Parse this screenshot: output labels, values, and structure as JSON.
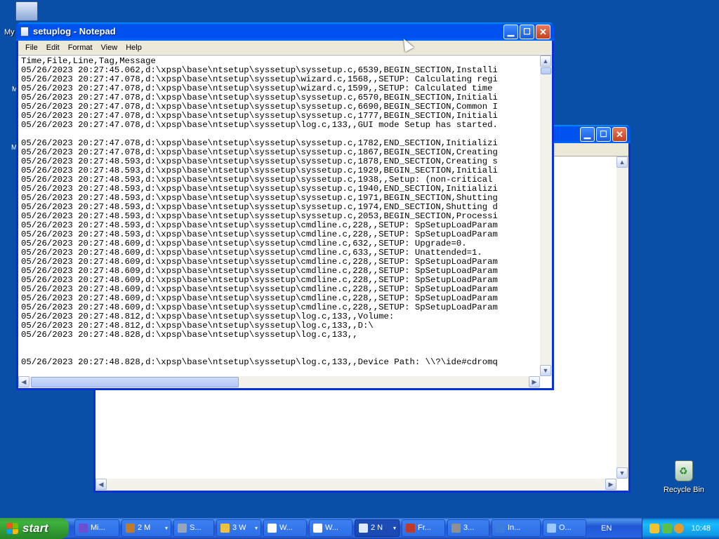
{
  "desktop": {
    "my_computer_label": "My",
    "fragment_1": "M",
    "fragment_2": "M",
    "recycle_bin_label": "Recycle Bin"
  },
  "notepad": {
    "title": "setuplog - Notepad",
    "menu": [
      "File",
      "Edit",
      "Format",
      "View",
      "Help"
    ],
    "lines": [
      "Time,File,Line,Tag,Message",
      "05/26/2023 20:27:45.062,d:\\xpsp\\base\\ntsetup\\syssetup\\syssetup.c,6539,BEGIN_SECTION,Installi",
      "05/26/2023 20:27:47.078,d:\\xpsp\\base\\ntsetup\\syssetup\\wizard.c,1568,,SETUP: Calculating regi",
      "05/26/2023 20:27:47.078,d:\\xpsp\\base\\ntsetup\\syssetup\\wizard.c,1599,,SETUP: Calculated time",
      "05/26/2023 20:27:47.078,d:\\xpsp\\base\\ntsetup\\syssetup\\syssetup.c,6570,BEGIN_SECTION,Initiali",
      "05/26/2023 20:27:47.078,d:\\xpsp\\base\\ntsetup\\syssetup\\syssetup.c,6690,BEGIN_SECTION,Common I",
      "05/26/2023 20:27:47.078,d:\\xpsp\\base\\ntsetup\\syssetup\\syssetup.c,1777,BEGIN_SECTION,Initiali",
      "05/26/2023 20:27:47.078,d:\\xpsp\\base\\ntsetup\\syssetup\\log.c,133,,GUI mode Setup has started.",
      "",
      "05/26/2023 20:27:47.078,d:\\xpsp\\base\\ntsetup\\syssetup\\syssetup.c,1782,END_SECTION,Initializi",
      "05/26/2023 20:27:47.078,d:\\xpsp\\base\\ntsetup\\syssetup\\syssetup.c,1867,BEGIN_SECTION,Creating",
      "05/26/2023 20:27:48.593,d:\\xpsp\\base\\ntsetup\\syssetup\\syssetup.c,1878,END_SECTION,Creating s",
      "05/26/2023 20:27:48.593,d:\\xpsp\\base\\ntsetup\\syssetup\\syssetup.c,1929,BEGIN_SECTION,Initiali",
      "05/26/2023 20:27:48.593,d:\\xpsp\\base\\ntsetup\\syssetup\\syssetup.c,1938,,Setup: (non-critical",
      "05/26/2023 20:27:48.593,d:\\xpsp\\base\\ntsetup\\syssetup\\syssetup.c,1940,END_SECTION,Initializi",
      "05/26/2023 20:27:48.593,d:\\xpsp\\base\\ntsetup\\syssetup\\syssetup.c,1971,BEGIN_SECTION,Shutting",
      "05/26/2023 20:27:48.593,d:\\xpsp\\base\\ntsetup\\syssetup\\syssetup.c,1974,END_SECTION,Shutting d",
      "05/26/2023 20:27:48.593,d:\\xpsp\\base\\ntsetup\\syssetup\\syssetup.c,2053,BEGIN_SECTION,Processi",
      "05/26/2023 20:27:48.593,d:\\xpsp\\base\\ntsetup\\syssetup\\cmdline.c,228,,SETUP: SpSetupLoadParam",
      "05/26/2023 20:27:48.593,d:\\xpsp\\base\\ntsetup\\syssetup\\cmdline.c,228,,SETUP: SpSetupLoadParam",
      "05/26/2023 20:27:48.609,d:\\xpsp\\base\\ntsetup\\syssetup\\cmdline.c,632,,SETUP: Upgrade=0.",
      "05/26/2023 20:27:48.609,d:\\xpsp\\base\\ntsetup\\syssetup\\cmdline.c,633,,SETUP: Unattended=1.",
      "05/26/2023 20:27:48.609,d:\\xpsp\\base\\ntsetup\\syssetup\\cmdline.c,228,,SETUP: SpSetupLoadParam",
      "05/26/2023 20:27:48.609,d:\\xpsp\\base\\ntsetup\\syssetup\\cmdline.c,228,,SETUP: SpSetupLoadParam",
      "05/26/2023 20:27:48.609,d:\\xpsp\\base\\ntsetup\\syssetup\\cmdline.c,228,,SETUP: SpSetupLoadParam",
      "05/26/2023 20:27:48.609,d:\\xpsp\\base\\ntsetup\\syssetup\\cmdline.c,228,,SETUP: SpSetupLoadParam",
      "05/26/2023 20:27:48.609,d:\\xpsp\\base\\ntsetup\\syssetup\\cmdline.c,228,,SETUP: SpSetupLoadParam",
      "05/26/2023 20:27:48.609,d:\\xpsp\\base\\ntsetup\\syssetup\\cmdline.c,228,,SETUP: SpSetupLoadParam",
      "05/26/2023 20:27:48.812,d:\\xpsp\\base\\ntsetup\\syssetup\\log.c,133,,Volume:",
      "05/26/2023 20:27:48.812,d:\\xpsp\\base\\ntsetup\\syssetup\\log.c,133,,D:\\",
      "05/26/2023 20:27:48.828,d:\\xpsp\\base\\ntsetup\\syssetup\\log.c,133,,",
      "",
      "",
      "05/26/2023 20:27:48.828,d:\\xpsp\\base\\ntsetup\\syssetup\\log.c,133,,Device Path: \\\\?\\ide#cdromq"
    ]
  },
  "taskbar": {
    "start_label": "start",
    "tasks": [
      {
        "label": "Mi...",
        "color": "#6a4fd0"
      },
      {
        "label": "2 M",
        "color": "#c07b2a",
        "arrow": "▾"
      },
      {
        "label": "S...",
        "color": "#9aa4b8"
      },
      {
        "label": "3 W",
        "color": "#f0c040",
        "arrow": "▾"
      },
      {
        "label": "W...",
        "color": "#ffffff"
      },
      {
        "label": "W...",
        "color": "#ffffff"
      },
      {
        "label": "2 N",
        "color": "#dfe9ff",
        "arrow": "▾"
      },
      {
        "label": "Fr...",
        "color": "#c0392b"
      },
      {
        "label": "3...",
        "color": "#8f8f8f"
      },
      {
        "label": "In...",
        "color": "#3b7ddd"
      },
      {
        "label": "O...",
        "color": "#9bc7ff"
      }
    ],
    "language": "EN",
    "clock": "10:48"
  }
}
